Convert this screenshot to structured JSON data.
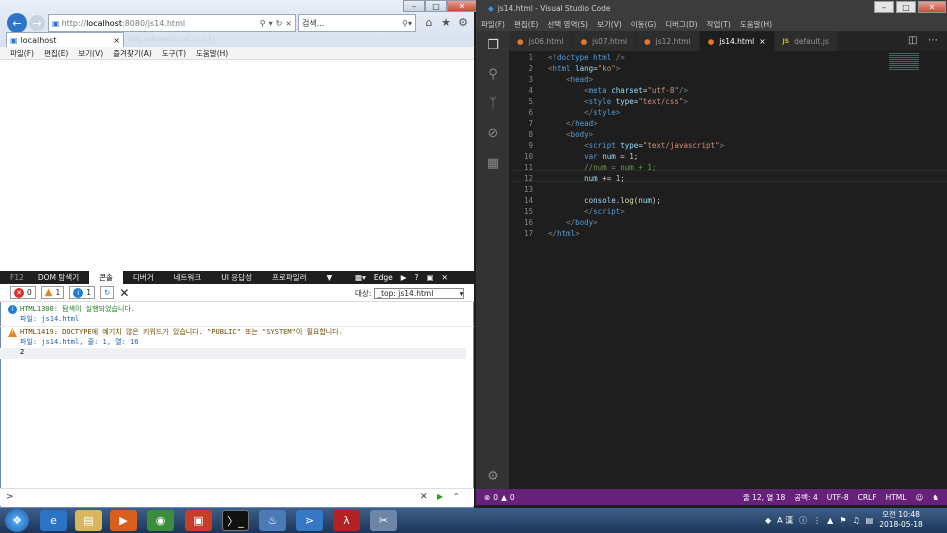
{
  "ie": {
    "address_prefix": "http://",
    "address_host": "localhost",
    "address_rest": ":8080/js14.html",
    "address_overlay": "blog.soltaoresh.net.com.kr",
    "search_placeholder": "검색...",
    "tab_title": "localhost",
    "menu": [
      "파일(F)",
      "편집(E)",
      "보기(V)",
      "즐겨찾기(A)",
      "도구(T)",
      "도움말(H)"
    ]
  },
  "f12": {
    "label": "F12",
    "tabs": [
      "DOM 탐색기",
      "콘솔",
      "디버거",
      "네트워크",
      "UI 응답성",
      "프로파일러"
    ],
    "active_tab": "콘솔",
    "mode": "Edge",
    "errors": "0",
    "warnings": "1",
    "infos": "1",
    "target_label": "대상:",
    "target_value": "_top: js14.html",
    "messages": [
      {
        "line1": "HTML1300: 탐색이 실행되었습니다.",
        "line2": "파일: js14.html"
      },
      {
        "line1": "HTML1419: DOCTYPE에 예기치 않은 키워드가 있습니다. \"PUBLIC\" 또는 \"SYSTEM\"이 필요합니다.",
        "line2": "파일: js14.html, 줄: 1, 열: 16"
      }
    ],
    "output": "2",
    "prompt": ">"
  },
  "vscode": {
    "title": "js14.html - Visual Studio Code",
    "menu": [
      "파일(F)",
      "편집(E)",
      "선택 영역(S)",
      "보기(V)",
      "이동(G)",
      "디버그(D)",
      "작업(T)",
      "도움말(H)"
    ],
    "tabs": [
      {
        "label": "js06.html",
        "type": "html"
      },
      {
        "label": "js07.html",
        "type": "html"
      },
      {
        "label": "js12.html",
        "type": "html"
      },
      {
        "label": "js14.html",
        "type": "html",
        "active": true
      },
      {
        "label": "default.js",
        "type": "js"
      }
    ],
    "js_badge": "JS",
    "line_numbers": [
      "1",
      "2",
      "3",
      "4",
      "5",
      "6",
      "7",
      "8",
      "9",
      "10",
      "11",
      "12",
      "13",
      "14",
      "15",
      "16",
      "17"
    ],
    "status": {
      "errors": "0",
      "warnings": "0",
      "position": "줄 12, 열 18",
      "spaces": "공백: 4",
      "encoding": "UTF-8",
      "eol": "CRLF",
      "language": "HTML"
    }
  },
  "taskbar": {
    "time": "오전 10:48",
    "date": "2018-05-18",
    "ime": "A 漢"
  }
}
